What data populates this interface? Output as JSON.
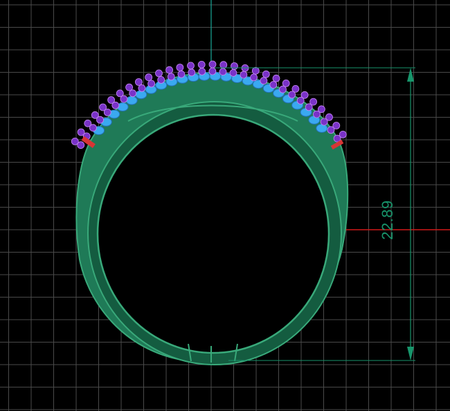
{
  "viewport": {
    "background": "#000000",
    "grid_color": "#4a4a4a",
    "axis_vertical_color": "#19a89a",
    "axis_horizontal_color": "#d01818"
  },
  "model": {
    "band_color": "#1f7a57",
    "band_highlight": "#39a97a",
    "band_shadow": "#145c40",
    "setting_color": "#3aa9f0",
    "stone_color": "#7a32c8",
    "stone_highlight": "#c58af2",
    "end_marker_color": "#d83535"
  },
  "dimension": {
    "value": "22.89",
    "color": "#17956b"
  }
}
